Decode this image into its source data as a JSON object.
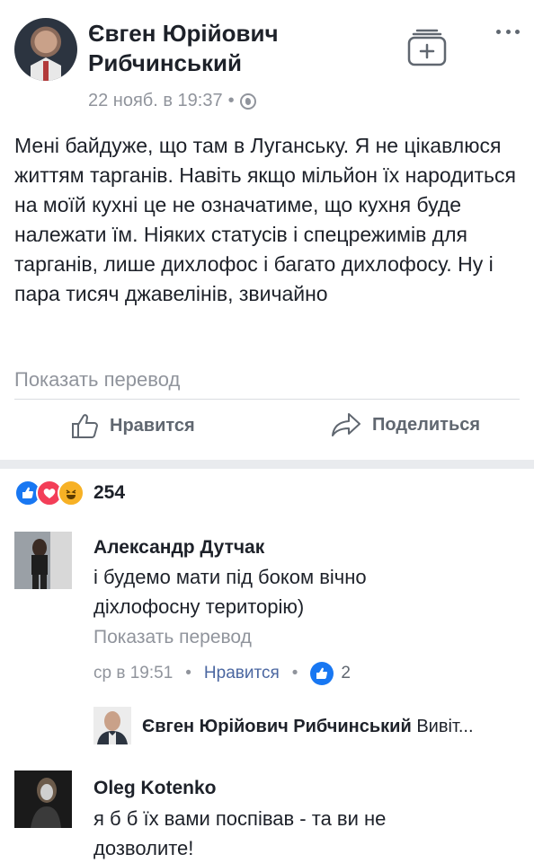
{
  "post": {
    "author": "Євген Юрійович Рибчинський",
    "timestamp": "22 нояб. в 19:37",
    "separator": "•",
    "text": "Мені байдуже, що там в Луганську. Я не цікавлюся життям тарганів. Навіть якщо мільйон їх народиться на моїй кухні це не означатиме, що кухня буде належати їм. Ніяких статусів і спецрежимів для тарганів, лише дихлофос і багато дихлофосу. Ну і пара тисяч джавелінів, звичайно",
    "show_translation": "Показать перевод"
  },
  "actions": {
    "like": "Нравится",
    "share": "Поделиться"
  },
  "reactions": {
    "count": "254",
    "types": [
      "like",
      "love",
      "haha"
    ]
  },
  "comments": [
    {
      "author": "Александр Дутчак",
      "text": "і будемо мати під боком вічно діхлофосну територію)",
      "show_translation": "Показать перевод",
      "time": "ср в 19:51",
      "like_label": "Нравится",
      "like_count": "2",
      "reply": {
        "author": "Євген Юрійович Рибчинський",
        "preview": "Вивіт..."
      }
    },
    {
      "author": "Oleg Kotenko",
      "text": "я б б їх вами поспівав - та ви не дозволите!"
    }
  ],
  "colors": {
    "link": "#4b67a1",
    "meta": "#90949c",
    "like_blue": "#1877f2",
    "love_red": "#f33e58",
    "haha_yellow": "#f7b125"
  }
}
